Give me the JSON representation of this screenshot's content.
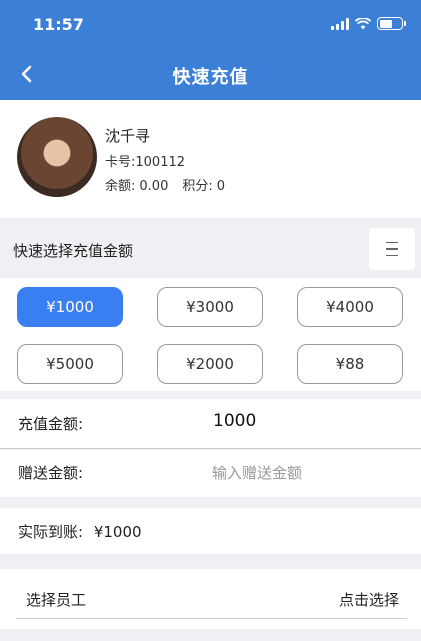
{
  "status_bar": {
    "time": "11:57"
  },
  "header": {
    "title": "快速充值"
  },
  "profile": {
    "name": "沈千寻",
    "card_label": "卡号:",
    "card_number": "100112",
    "balance_label": "余额:",
    "balance": "0.00",
    "points_label": "积分:",
    "points": "0"
  },
  "quick_select": {
    "label": "快速选择充值金额"
  },
  "amount_options": [
    "¥1000",
    "¥3000",
    "¥4000",
    "¥5000",
    "¥2000",
    "¥88"
  ],
  "selected_amount_index": 0,
  "recharge": {
    "label": "充值金额:",
    "value": "1000"
  },
  "gift": {
    "label": "赠送金额:",
    "placeholder": "输入赠送金额",
    "value": ""
  },
  "actual": {
    "label": "实际到账:",
    "value": "¥1000"
  },
  "staff": {
    "label": "选择员工",
    "action": "点击选择"
  },
  "colors": {
    "header": "#3b7fd6",
    "accent": "#3a7ff1",
    "page_bg": "#efeff4"
  }
}
